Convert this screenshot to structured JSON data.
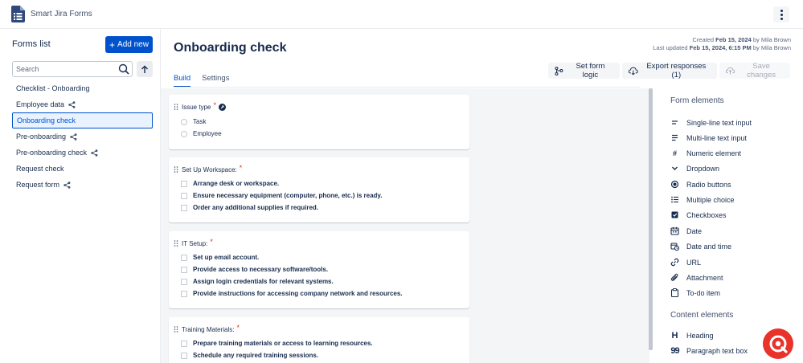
{
  "app": {
    "title": "Smart Jira Forms"
  },
  "sidebar": {
    "title": "Forms list",
    "add_label": "Add new",
    "search_placeholder": "Search",
    "items": [
      {
        "label": "Checklist - Onboarding",
        "shared": false
      },
      {
        "label": "Employee data",
        "shared": true
      },
      {
        "label": "Onboarding check",
        "shared": false,
        "active": true
      },
      {
        "label": "Pre-onboarding",
        "shared": true
      },
      {
        "label": "Pre-onboarding check",
        "shared": true
      },
      {
        "label": "Request check",
        "shared": false
      },
      {
        "label": "Request form",
        "shared": true
      }
    ]
  },
  "main": {
    "title": "Onboarding check",
    "created_prefix": "Created",
    "created_date": "Feb 15, 2024",
    "created_by_prefix": "by",
    "created_by": "Mila Brown",
    "updated_prefix": "Last updated",
    "updated_date": "Feb 15, 2024, 6:15 PM",
    "updated_by_prefix": "by",
    "updated_by": "Mila Brown",
    "tabs": [
      {
        "label": "Build"
      },
      {
        "label": "Settings"
      }
    ],
    "buttons": {
      "logic": "Set form logic",
      "export": "Export responses (1)",
      "save": "Save changes"
    }
  },
  "cards": [
    {
      "title": "Issue type",
      "options": [
        "Task",
        "Employee"
      ]
    },
    {
      "title": "Set Up Workspace:",
      "options": [
        "Arrange desk or workspace.",
        "Ensure necessary equipment (computer, phone, etc.) is ready.",
        "Order any additional supplies if required."
      ]
    },
    {
      "title": "IT Setup:",
      "options": [
        "Set up email account.",
        "Provide access to necessary software/tools.",
        "Assign login credentials for relevant systems.",
        "Provide instructions for accessing company network and resources."
      ]
    },
    {
      "title": "Training Materials:",
      "options": [
        "Prepare training materials or access to learning resources.",
        "Schedule any required training sessions."
      ]
    }
  ],
  "panel": {
    "form_title": "Form elements",
    "form_elements": [
      "Single-line text input",
      "Multi-line text input",
      "Numeric element",
      "Dropdown",
      "Radio buttons",
      "Multiple choice",
      "Checkboxes",
      "Date",
      "Date and time",
      "URL",
      "Attachment",
      "To-do item"
    ],
    "content_title": "Content elements",
    "content_elements": [
      "Heading",
      "Paragraph text box"
    ],
    "icons": {
      "number": "#",
      "heading": "H",
      "quote": "99"
    }
  },
  "colors": {
    "primary": "#0052cc",
    "fab": "#e8322a"
  }
}
